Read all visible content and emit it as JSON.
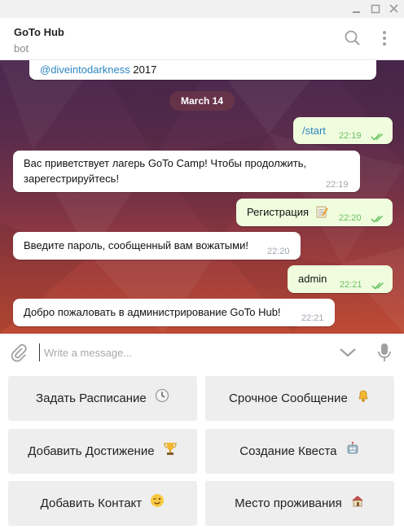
{
  "window": {
    "controls": [
      "minimize-icon",
      "maximize-icon",
      "close-icon"
    ]
  },
  "header": {
    "title": "GoTo Hub",
    "subtitle": "bot",
    "icons": [
      "search-icon",
      "more-vertical-icon"
    ]
  },
  "chat": {
    "prev_message": {
      "mention": "@diveintodarkness",
      "rest": " 2017"
    },
    "date_divider": "March 14",
    "messages": [
      {
        "direction": "outgoing",
        "text": "/start",
        "time": "22:19",
        "status": "read"
      },
      {
        "direction": "incoming",
        "text_line1": "Вас приветствует лагерь GoTo Camp! Чтобы продолжить,",
        "text_line2": "зарегестрируйтесь!",
        "time": "22:19"
      },
      {
        "direction": "outgoing",
        "text": "Регистрация",
        "emoji": "memo-icon",
        "time": "22:20",
        "status": "read"
      },
      {
        "direction": "incoming",
        "text": "Введите пароль, сообщенный вам вожатыми!",
        "time": "22:20"
      },
      {
        "direction": "outgoing",
        "text": "admin",
        "time": "22:21",
        "status": "read"
      },
      {
        "direction": "incoming",
        "text": "Добро пожаловать в администрирование GoTo Hub!",
        "time": "22:21"
      }
    ]
  },
  "composer": {
    "placeholder": "Write a message...",
    "icons": [
      "attach-icon",
      "keyboard-toggle-icon",
      "microphone-icon"
    ]
  },
  "keyboard": {
    "buttons": [
      {
        "label": "Задать Расписание",
        "emoji": "clock-icon"
      },
      {
        "label": "Срочное Сообщение",
        "emoji": "bell-icon"
      },
      {
        "label": "Добавить Достижение",
        "emoji": "trophy-icon"
      },
      {
        "label": "Создание Квеста",
        "emoji": "robot-icon"
      },
      {
        "label": "Добавить Контакт",
        "emoji": "winking-face-icon"
      },
      {
        "label": "Место проживания",
        "emoji": "house-icon"
      }
    ]
  },
  "colors": {
    "incoming_bubble": "#ffffff",
    "outgoing_bubble": "#effdde",
    "read_ticks": "#5fbf5a",
    "link": "#2e86c1",
    "keyboard_button": "#eeeeee"
  }
}
